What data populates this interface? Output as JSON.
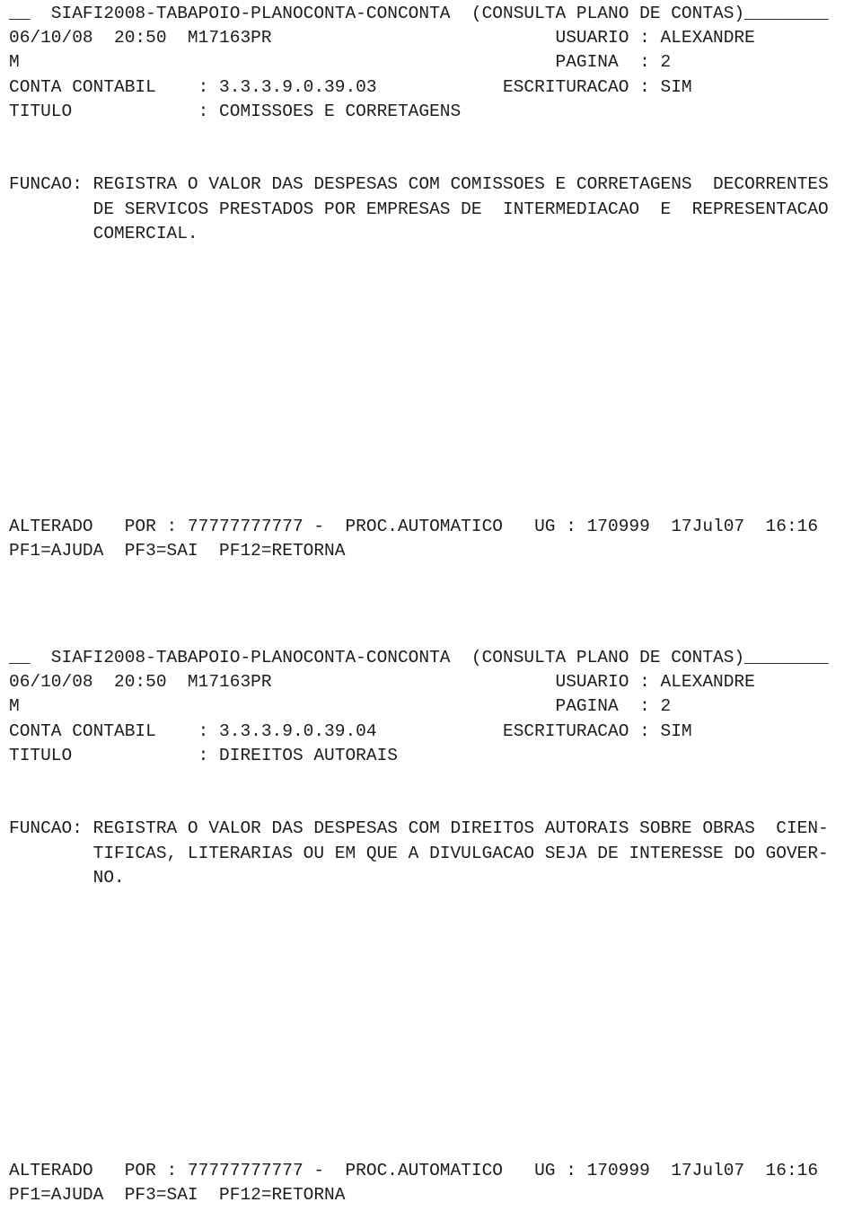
{
  "screen": {
    "system": "SIAFI2008",
    "path": "SIAFI2008-TABAPOIO-PLANOCONTA-CONCONTA",
    "title": "(CONSULTA PLANO DE CONTAS)",
    "header_line_prefix": "__",
    "header_line_suffix": "________",
    "header_full": "__  SIAFI2008-TABAPOIO-PLANOCONTA-CONCONTA  (CONSULTA PLANO DE CONTAS)________",
    "colors": {
      "background": "#ffffff",
      "text": "#1c1c1c"
    }
  },
  "blocks": [
    {
      "id": "block-0",
      "header": "__  SIAFI2008-TABAPOIO-PLANOCONTA-CONCONTA  (CONSULTA PLANO DE CONTAS)________",
      "date": "06/10/08",
      "time": "20:50",
      "terminal": "M17163PR",
      "user_label": "USUARIO",
      "user_value": "ALEXANDRE",
      "mode": "M",
      "page_label": "PAGINA",
      "page_value": "2",
      "conta_label": "CONTA CONTABIL",
      "conta_value": "3.3.3.9.0.39.03",
      "escrituracao_label": "ESCRITURACAO",
      "escrituracao_value": "SIM",
      "titulo_label": "TITULO",
      "titulo_value": "COMISSOES E CORRETAGENS",
      "funcao_label": "FUNCAO:",
      "funcao_lines": [
        "REGISTRA O VALOR DAS DESPESAS COM COMISSOES E CORRETAGENS  DECORRENTES",
        "DE SERVICOS PRESTADOS POR EMPRESAS DE  INTERMEDIACAO  E  REPRESENTACAO",
        "COMERCIAL."
      ],
      "altered_label": "ALTERADO",
      "altered_by_label": "POR :",
      "altered_by_value": "77777777777",
      "altered_by_name": "PROC.AUTOMATICO",
      "ug_label": "UG :",
      "ug_value": "170999",
      "altered_date": "17Jul07",
      "altered_time": "16:16",
      "pfkeys": "PF1=AJUDA  PF3=SAI  PF12=RETORNA",
      "lines": [
        "__  SIAFI2008-TABAPOIO-PLANOCONTA-CONCONTA  (CONSULTA PLANO DE CONTAS)________",
        "06/10/08  20:50  M17163PR                           USUARIO : ALEXANDRE",
        "M                                                   PAGINA  : 2",
        "CONTA CONTABIL    : 3.3.3.9.0.39.03            ESCRITURACAO : SIM",
        "TITULO            : COMISSOES E CORRETAGENS",
        "",
        "",
        "FUNCAO: REGISTRA O VALOR DAS DESPESAS COM COMISSOES E CORRETAGENS  DECORRENTES",
        "        DE SERVICOS PRESTADOS POR EMPRESAS DE  INTERMEDIACAO  E  REPRESENTACAO",
        "        COMERCIAL.",
        "",
        "",
        "",
        "",
        "",
        "",
        "",
        "",
        "",
        "",
        "",
        "ALTERADO   POR : 77777777777 -  PROC.AUTOMATICO   UG : 170999  17Jul07  16:16",
        "PF1=AJUDA  PF3=SAI  PF12=RETORNA"
      ]
    },
    {
      "id": "block-1",
      "header": "__  SIAFI2008-TABAPOIO-PLANOCONTA-CONCONTA  (CONSULTA PLANO DE CONTAS)________",
      "date": "06/10/08",
      "time": "20:50",
      "terminal": "M17163PR",
      "user_label": "USUARIO",
      "user_value": "ALEXANDRE",
      "mode": "M",
      "page_label": "PAGINA",
      "page_value": "2",
      "conta_label": "CONTA CONTABIL",
      "conta_value": "3.3.3.9.0.39.04",
      "escrituracao_label": "ESCRITURACAO",
      "escrituracao_value": "SIM",
      "titulo_label": "TITULO",
      "titulo_value": "DIREITOS AUTORAIS",
      "funcao_label": "FUNCAO:",
      "funcao_lines": [
        "REGISTRA O VALOR DAS DESPESAS COM DIREITOS AUTORAIS SOBRE OBRAS  CIEN-",
        "TIFICAS, LITERARIAS OU EM QUE A DIVULGACAO SEJA DE INTERESSE DO GOVER-",
        "NO."
      ],
      "altered_label": "ALTERADO",
      "altered_by_label": "POR :",
      "altered_by_value": "77777777777",
      "altered_by_name": "PROC.AUTOMATICO",
      "ug_label": "UG :",
      "ug_value": "170999",
      "altered_date": "17Jul07",
      "altered_time": "16:16",
      "pfkeys": "PF1=AJUDA  PF3=SAI  PF12=RETORNA",
      "lines": [
        "__  SIAFI2008-TABAPOIO-PLANOCONTA-CONCONTA  (CONSULTA PLANO DE CONTAS)________",
        "06/10/08  20:50  M17163PR                           USUARIO : ALEXANDRE",
        "M                                                   PAGINA  : 2",
        "CONTA CONTABIL    : 3.3.3.9.0.39.04            ESCRITURACAO : SIM",
        "TITULO            : DIREITOS AUTORAIS",
        "",
        "",
        "FUNCAO: REGISTRA O VALOR DAS DESPESAS COM DIREITOS AUTORAIS SOBRE OBRAS  CIEN-",
        "        TIFICAS, LITERARIAS OU EM QUE A DIVULGACAO SEJA DE INTERESSE DO GOVER-",
        "        NO.",
        "",
        "",
        "",
        "",
        "",
        "",
        "",
        "",
        "",
        "",
        "",
        "ALTERADO   POR : 77777777777 -  PROC.AUTOMATICO   UG : 170999  17Jul07  16:16",
        "PF1=AJUDA  PF3=SAI  PF12=RETORNA"
      ]
    }
  ]
}
